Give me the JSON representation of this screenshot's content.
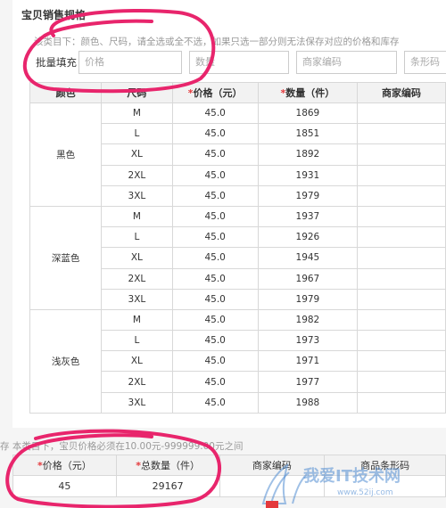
{
  "section": {
    "title": "宝贝销售规格",
    "hint": "该类目下：颜色、尺码，请全选或全不选，如果只选一部分则无法保存对应的价格和库存"
  },
  "bulk": {
    "label": "批量填充：",
    "price_placeholder": "价格",
    "qty_placeholder": "数量",
    "code_placeholder": "商家编码",
    "barcode_placeholder": "条形码"
  },
  "table": {
    "headers": {
      "color": "颜色",
      "size": "尺码",
      "price": "价格（元）",
      "qty": "数量（件）",
      "code": "商家编码"
    },
    "required_mark": "*",
    "groups": [
      {
        "color": "黑色",
        "rows": [
          {
            "size": "M",
            "price": "45.0",
            "qty": "1869"
          },
          {
            "size": "L",
            "price": "45.0",
            "qty": "1851"
          },
          {
            "size": "XL",
            "price": "45.0",
            "qty": "1892"
          },
          {
            "size": "2XL",
            "price": "45.0",
            "qty": "1931"
          },
          {
            "size": "3XL",
            "price": "45.0",
            "qty": "1979"
          }
        ]
      },
      {
        "color": "深蓝色",
        "rows": [
          {
            "size": "M",
            "price": "45.0",
            "qty": "1937"
          },
          {
            "size": "L",
            "price": "45.0",
            "qty": "1926"
          },
          {
            "size": "XL",
            "price": "45.0",
            "qty": "1945"
          },
          {
            "size": "2XL",
            "price": "45.0",
            "qty": "1967"
          },
          {
            "size": "3XL",
            "price": "45.0",
            "qty": "1979"
          }
        ]
      },
      {
        "color": "浅灰色",
        "rows": [
          {
            "size": "M",
            "price": "45.0",
            "qty": "1982"
          },
          {
            "size": "L",
            "price": "45.0",
            "qty": "1973"
          },
          {
            "size": "XL",
            "price": "45.0",
            "qty": "1971"
          },
          {
            "size": "2XL",
            "price": "45.0",
            "qty": "1977"
          },
          {
            "size": "3XL",
            "price": "45.0",
            "qty": "1988"
          }
        ]
      }
    ]
  },
  "summary": {
    "hint": "存  本类目下，宝贝价格必须在10.00元-999999.00元之间",
    "headers": {
      "price": "价格（元）",
      "total_qty": "总数量（件）",
      "code": "商家编码",
      "barcode": "商品条形码"
    },
    "values": {
      "price": "45",
      "total_qty": "29167"
    }
  },
  "watermark": {
    "text": "我爱IT技术网",
    "url": "www.52ij.com"
  },
  "colors": {
    "required": "#e4393c",
    "annotation": "#e8256c",
    "header_bg": "#f2f2f2",
    "border": "#d8d8d8"
  }
}
